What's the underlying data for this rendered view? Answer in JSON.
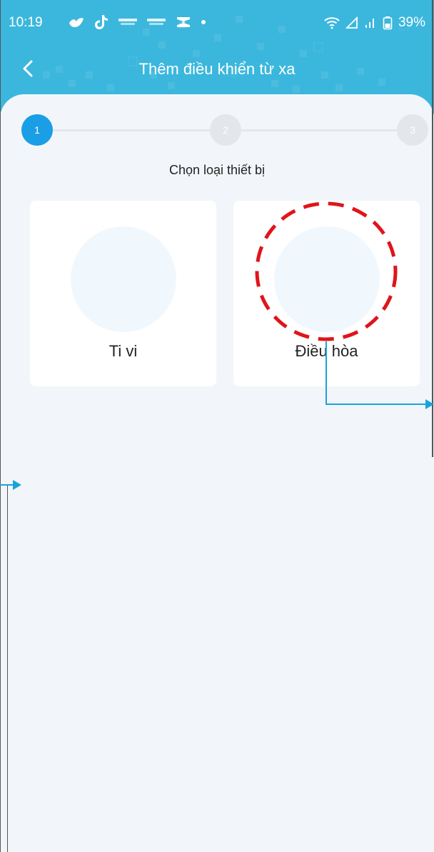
{
  "status_bar": {
    "time": "10:19",
    "battery": "39%",
    "left_icons": [
      "bird-icon",
      "tiktok-icon",
      "kiotviet-icon",
      "kiotviet-icon",
      "capcut-icon",
      "dot-icon"
    ],
    "right_icons": [
      "wifi-icon",
      "signal-off-icon",
      "signal-icon",
      "battery-icon"
    ]
  },
  "header": {
    "title": "Thêm điều khiển từ xa",
    "back_icon": "chevron-left-icon"
  },
  "stepper": {
    "steps": [
      {
        "label": "1",
        "active": true
      },
      {
        "label": "2",
        "active": false
      },
      {
        "label": "3",
        "active": false
      }
    ]
  },
  "section": {
    "subtitle": "Chọn loại thiết bị"
  },
  "devices": [
    {
      "label": "Ti vi"
    },
    {
      "label": "Điều hòa"
    }
  ],
  "colors": {
    "header": "#3bb7dd",
    "active_step": "#1a9ee6",
    "annotation_circle": "#e0141b",
    "annotation_arrow": "#1aa3d9"
  }
}
